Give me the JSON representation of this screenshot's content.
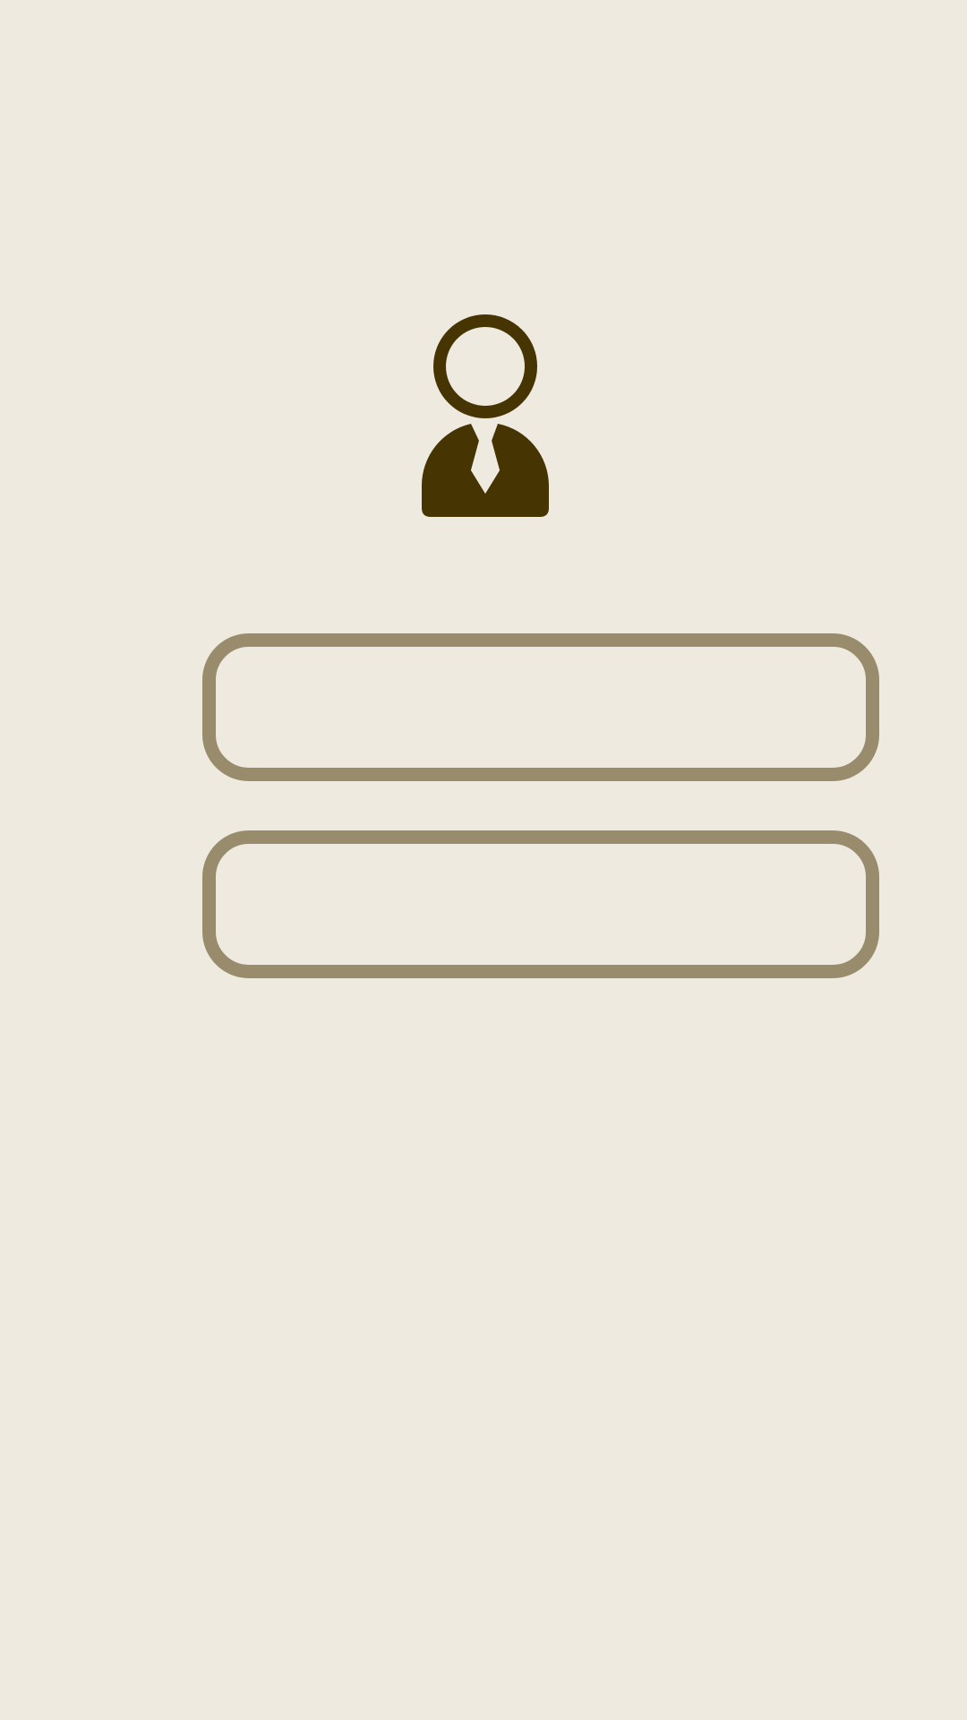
{
  "screen": {
    "background_color": "#EEEADF"
  },
  "avatar": {
    "icon": "user-avatar-icon",
    "color": "#463502"
  },
  "form": {
    "field_border_color": "#998C6D",
    "username": {
      "value": "",
      "placeholder": ""
    },
    "password": {
      "value": "",
      "placeholder": ""
    }
  }
}
